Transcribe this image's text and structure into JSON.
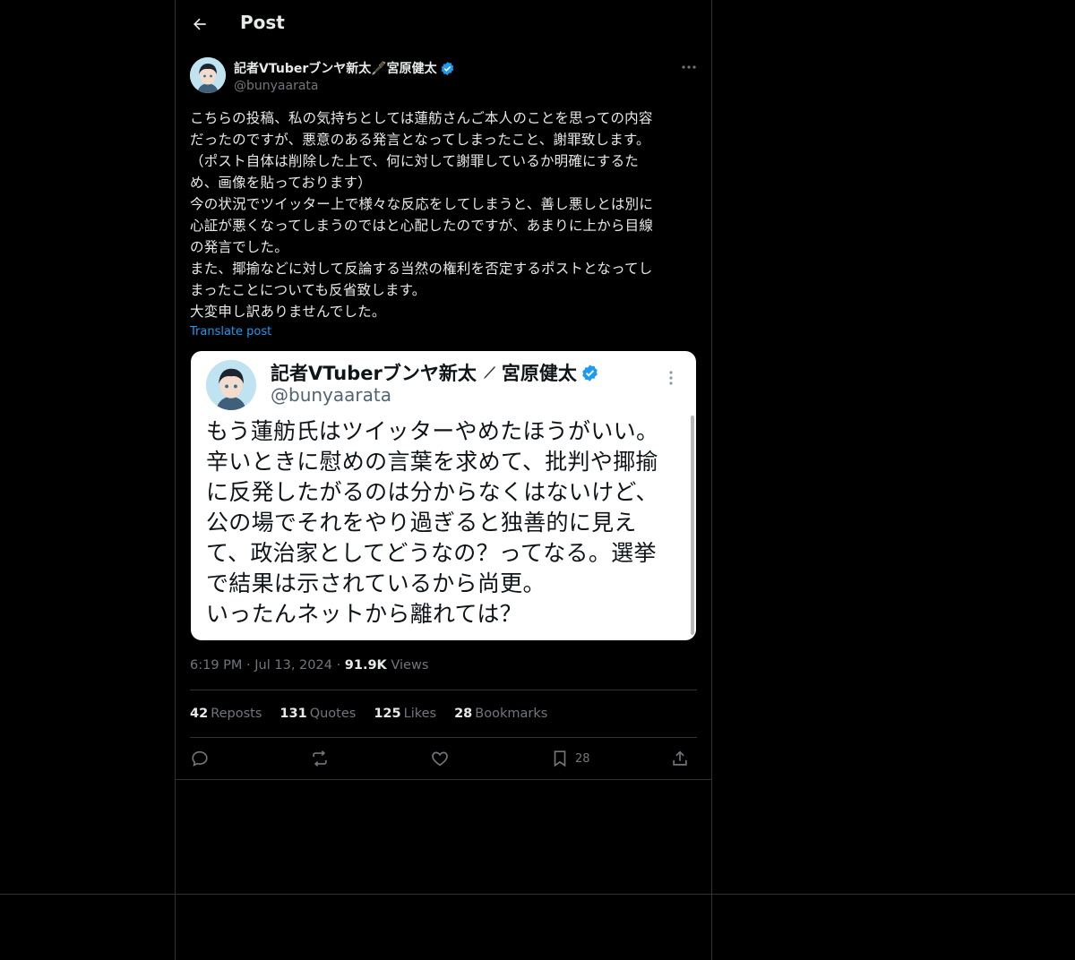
{
  "header": {
    "title": "Post"
  },
  "author": {
    "name": "記者VTuberブンヤ新太🖋️宮原健太",
    "handle": "@bunyaarata",
    "verified": true
  },
  "post": {
    "text": "こちらの投稿、私の気持ちとしては蓮舫さんご本人のことを思っての内容\nだったのですが、悪意のある発言となってしまったこと、謝罪致します。\n（ポスト自体は削除した上で、何に対して謝罪しているか明確にするた\nめ、画像を貼っております）\n今の状況でツイッター上で様々な反応をしてしまうと、善し悪しとは別に\n心証が悪くなってしまうのではと心配したのですが、あまりに上から目線\nの発言でした。\nまた、揶揄などに対して反論する当然の権利を否定するポストとなってし\nまったことについても反省致します。\n大変申し訳ありませんでした。",
    "translate_label": "Translate post",
    "time": "6:19 PM",
    "date": "Jul 13, 2024",
    "views_count": "91.9K",
    "views_label": "Views"
  },
  "embed": {
    "name": "記者VTuberブンヤ新太",
    "name_suffix": "宮原健太",
    "handle": "@bunyaarata",
    "text": "もう蓮舫氏はツイッターやめたほうがいい。\n辛いときに慰めの言葉を求めて、批判や揶揄\nに反発したがるのは分からなくはないけど、\n公の場でそれをやり過ぎると独善的に見え\nて、政治家としてどうなの？ってなる。選挙\nで結果は示されているから尚更。\nいったんネットから離れては？"
  },
  "stats": {
    "reposts_count": "42",
    "reposts_label": "Reposts",
    "quotes_count": "131",
    "quotes_label": "Quotes",
    "likes_count": "125",
    "likes_label": "Likes",
    "bookmarks_count": "28",
    "bookmarks_label": "Bookmarks"
  },
  "actions": {
    "bookmark_count": "28"
  },
  "colors": {
    "background": "#000000",
    "text": "#e7e9ea",
    "muted": "#71767b",
    "accent": "#1d9bf0",
    "border": "#2f3336"
  }
}
